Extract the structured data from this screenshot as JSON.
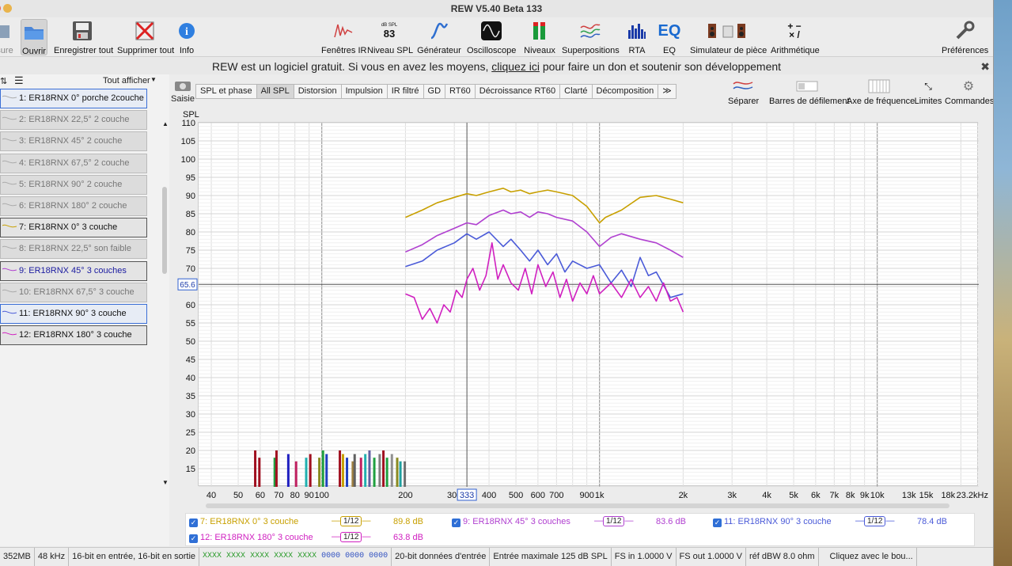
{
  "window": {
    "title": "REW V5.40 Beta 133"
  },
  "toolbar": {
    "items": [
      {
        "label": "sure",
        "icon": "measure-icon"
      },
      {
        "label": "Ouvrir",
        "icon": "folder-icon"
      },
      {
        "label": "Enregistrer tout",
        "icon": "save-icon"
      },
      {
        "label": "Supprimer tout",
        "icon": "delete-icon"
      },
      {
        "label": "Info",
        "icon": "info-icon"
      },
      {
        "label": "Fenêtres IR",
        "icon": "ir-windows-icon"
      },
      {
        "label": "Niveau SPL",
        "icon": "spl-meter-icon",
        "meter_unit": "dB SPL",
        "meter_value": "83"
      },
      {
        "label": "Générateur",
        "icon": "generator-icon"
      },
      {
        "label": "Oscilloscope",
        "icon": "oscilloscope-icon"
      },
      {
        "label": "Niveaux",
        "icon": "levels-icon"
      },
      {
        "label": "Superpositions",
        "icon": "overlays-icon"
      },
      {
        "label": "RTA",
        "icon": "rta-icon"
      },
      {
        "label": "EQ",
        "icon": "eq-icon"
      },
      {
        "label": "Simulateur de pièce",
        "icon": "room-sim-icon"
      },
      {
        "label": "Arithmétique",
        "icon": "arithmetic-icon"
      },
      {
        "label": "Préférences",
        "icon": "preferences-icon"
      }
    ]
  },
  "banner": {
    "before": "REW est un logiciel gratuit. Si vous en avez les moyens, ",
    "link": "cliquez ici",
    "after": " pour faire un don et soutenir son développement",
    "close": "✖"
  },
  "sidebar": {
    "show_all": "Tout afficher",
    "measurements": [
      {
        "label": "1: ER18RNX 0° porche 2couche",
        "state": "hl"
      },
      {
        "label": "2: ER18RNX 22,5° 2 couche",
        "state": ""
      },
      {
        "label": "3: ER18RNX 45° 2 couche",
        "state": ""
      },
      {
        "label": "4: ER18RNX 67,5° 2 couche",
        "state": ""
      },
      {
        "label": "5: ER18RNX 90° 2 couche",
        "state": ""
      },
      {
        "label": "6: ER18RNX 180° 2 couche",
        "state": ""
      },
      {
        "label": "7: ER18RNX 0° 3 couche",
        "state": "sel",
        "color": "#c8a000"
      },
      {
        "label": "8: ER18RNX 22,5° son faible",
        "state": ""
      },
      {
        "label": "9: ER18RNX 45° 3 couches",
        "state": "sel",
        "color": "#b040d0",
        "text_color": "#1a1aa0"
      },
      {
        "label": "10: ER18RNX 67,5° 3 couche",
        "state": ""
      },
      {
        "label": "11: ER18RNX 90° 3 couche",
        "state": "hl",
        "color": "#4a5ad8"
      },
      {
        "label": "12: ER18RNX 180° 3 couche",
        "state": "sel",
        "color": "#d020c0"
      }
    ]
  },
  "graph": {
    "capture_label": "Saisie",
    "tabs": [
      "SPL et phase",
      "All SPL",
      "Distorsion",
      "Impulsion",
      "IR filtré",
      "GD",
      "RT60",
      "Décroissance RT60",
      "Clarté",
      "Décomposition",
      "≫"
    ],
    "active_tab": "All SPL",
    "right_tools": [
      {
        "label": "Séparer",
        "icon": "separate-icon"
      },
      {
        "label": "Barres de défilement",
        "icon": "scrollbars-icon"
      },
      {
        "label": "Axe de fréquence",
        "icon": "freq-axis-icon"
      },
      {
        "label": "Limites",
        "icon": "limits-icon"
      },
      {
        "label": "Commandes",
        "icon": "controls-icon"
      }
    ],
    "cursor_y_label": "65.6",
    "cursor_x_label": "333"
  },
  "chart_data": {
    "type": "line",
    "title": "",
    "ylabel": "SPL",
    "xlabel": "",
    "xscale": "log",
    "xlim": [
      36,
      23200
    ],
    "ylim": [
      10,
      110
    ],
    "grid": true,
    "y_ticks": [
      110,
      105,
      100,
      95,
      90,
      85,
      80,
      75,
      70,
      65,
      60,
      55,
      50,
      45,
      40,
      35,
      30,
      25,
      20,
      15
    ],
    "x_ticks": [
      {
        "v": 40,
        "l": "40"
      },
      {
        "v": 50,
        "l": "50"
      },
      {
        "v": 60,
        "l": "60"
      },
      {
        "v": 70,
        "l": "70"
      },
      {
        "v": 80,
        "l": "80"
      },
      {
        "v": 90,
        "l": "90"
      },
      {
        "v": 100,
        "l": "100"
      },
      {
        "v": 200,
        "l": "200"
      },
      {
        "v": 300,
        "l": "300"
      },
      {
        "v": 400,
        "l": "400"
      },
      {
        "v": 500,
        "l": "500"
      },
      {
        "v": 600,
        "l": "600"
      },
      {
        "v": 700,
        "l": "700"
      },
      {
        "v": 900,
        "l": "900"
      },
      {
        "v": 1000,
        "l": "1k"
      },
      {
        "v": 2000,
        "l": "2k"
      },
      {
        "v": 3000,
        "l": "3k"
      },
      {
        "v": 4000,
        "l": "4k"
      },
      {
        "v": 5000,
        "l": "5k"
      },
      {
        "v": 6000,
        "l": "6k"
      },
      {
        "v": 7000,
        "l": "7k"
      },
      {
        "v": 8000,
        "l": "8k"
      },
      {
        "v": 9000,
        "l": "9k"
      },
      {
        "v": 10000,
        "l": "10k"
      },
      {
        "v": 13000,
        "l": "13k"
      },
      {
        "v": 15000,
        "l": "15k"
      },
      {
        "v": 18000,
        "l": "18k"
      },
      {
        "v": 23200,
        "l": "23.2kHz"
      }
    ],
    "cursor": {
      "x": 333,
      "y": 65.6
    },
    "series": [
      {
        "name": "7: ER18RNX 0° 3 couche",
        "color": "#c8a000",
        "x": [
          200,
          230,
          260,
          300,
          333,
          360,
          400,
          450,
          480,
          520,
          560,
          600,
          650,
          700,
          800,
          900,
          1000,
          1050,
          1200,
          1400,
          1600,
          1800,
          2000
        ],
        "y": [
          84,
          86,
          88,
          89.5,
          90.5,
          90,
          91,
          92,
          91,
          91.5,
          90.5,
          91,
          91.5,
          91,
          90,
          87,
          82.5,
          84,
          86,
          89.5,
          90,
          89,
          88
        ]
      },
      {
        "name": "9: ER18RNX 45° 3 couches",
        "color": "#b040d0",
        "x": [
          200,
          230,
          260,
          300,
          333,
          360,
          400,
          450,
          480,
          520,
          560,
          600,
          650,
          700,
          800,
          900,
          1000,
          1100,
          1200,
          1400,
          1600,
          1800,
          2000
        ],
        "y": [
          74.5,
          76.5,
          79,
          81,
          82.5,
          82,
          84.5,
          86,
          85,
          85.5,
          84,
          85.5,
          85,
          84,
          83,
          80,
          76,
          78.5,
          79.5,
          78,
          77,
          75,
          73
        ]
      },
      {
        "name": "11: ER18RNX 90° 3 couche",
        "color": "#4a5ad8",
        "x": [
          200,
          230,
          260,
          300,
          333,
          360,
          400,
          450,
          480,
          520,
          560,
          600,
          650,
          700,
          750,
          800,
          900,
          1000,
          1100,
          1200,
          1300,
          1400,
          1500,
          1600,
          1800,
          2000
        ],
        "y": [
          70.5,
          72,
          75,
          77,
          79.5,
          78,
          80,
          76,
          78,
          75,
          72,
          75,
          71,
          74,
          69,
          72,
          70,
          71,
          66,
          69.5,
          65,
          73,
          68,
          69,
          62,
          63
        ]
      },
      {
        "name": "12: ER18RNX 180° 3 couche",
        "color": "#d020c0",
        "x": [
          200,
          215,
          230,
          245,
          260,
          275,
          290,
          305,
          320,
          333,
          350,
          370,
          390,
          410,
          430,
          450,
          480,
          510,
          540,
          570,
          600,
          640,
          680,
          720,
          760,
          800,
          850,
          900,
          950,
          1000,
          1100,
          1200,
          1300,
          1400,
          1500,
          1600,
          1700,
          1800,
          1900,
          2000
        ],
        "y": [
          63,
          62,
          56,
          59,
          55,
          60,
          58,
          64,
          62,
          67,
          70,
          64,
          68,
          77,
          67,
          71,
          66,
          64,
          70,
          63,
          71,
          65,
          69,
          62,
          67,
          61,
          66,
          63,
          68,
          63,
          66,
          62,
          67,
          62,
          65,
          61,
          66,
          61,
          62,
          58
        ]
      }
    ],
    "bars": {
      "note": "RTA-like decorative bars near bottom-left",
      "x": [
        57,
        59,
        67,
        68,
        75,
        80,
        87,
        90,
        97,
        100,
        103,
        115,
        118,
        122,
        128,
        130,
        137,
        142,
        147,
        153,
        160,
        165,
        170,
        177,
        185,
        190,
        197
      ],
      "y": [
        20,
        18,
        18,
        20,
        19,
        17,
        18,
        19,
        18,
        20,
        19,
        20,
        19,
        18,
        17,
        19,
        18,
        19,
        20,
        18,
        19,
        20,
        18,
        19,
        18,
        17,
        17
      ],
      "colors": [
        "#a01020",
        "#a01020",
        "#20a040",
        "#a01020",
        "#2020c0",
        "#c02060",
        "#20b0b0",
        "#a01020",
        "#8a8a20",
        "#20a040",
        "#2040c0",
        "#a01020",
        "#c8a000",
        "#2040c0",
        "#a08040",
        "#606060",
        "#c02060",
        "#20b0b0",
        "#6060a0",
        "#20a040",
        "#808080",
        "#a01020",
        "#20a040",
        "#909090",
        "#8a8a20",
        "#20a0a0",
        "#707070"
      ]
    }
  },
  "legend": {
    "entries": [
      {
        "label": "7: ER18RNX 0° 3 couche",
        "smoothing": "1/12",
        "value": "89.8 dB",
        "color": "#c8a000"
      },
      {
        "label": "9: ER18RNX 45° 3 couches",
        "smoothing": "1/12",
        "value": "83.6 dB",
        "color": "#b040d0"
      },
      {
        "label": "11: ER18RNX 90° 3 couche",
        "smoothing": "1/12",
        "value": "78.4 dB",
        "color": "#4a5ad8"
      },
      {
        "label": "12: ER18RNX 180° 3 couche",
        "smoothing": "1/12",
        "value": "63.8 dB",
        "color": "#d020c0"
      }
    ]
  },
  "status": {
    "memory": "352MB",
    "rate": "48 kHz",
    "bits": "16-bit en entrée, 16-bit en sortie",
    "xx1": "XXXX XXXX",
    "xx2": "XXXX XXXX",
    "xx3": "XXXX",
    "zz": "0000 0000 0000",
    "input_bits": "20-bit données d'entrée",
    "max_input": "Entrée maximale 125 dB SPL",
    "fs_in": "FS in 1.0000 V",
    "fs_out": "FS out 1.0000 V",
    "ref": "réf dBW 8.0 ohm",
    "hint": "Cliquez avec le bou..."
  }
}
